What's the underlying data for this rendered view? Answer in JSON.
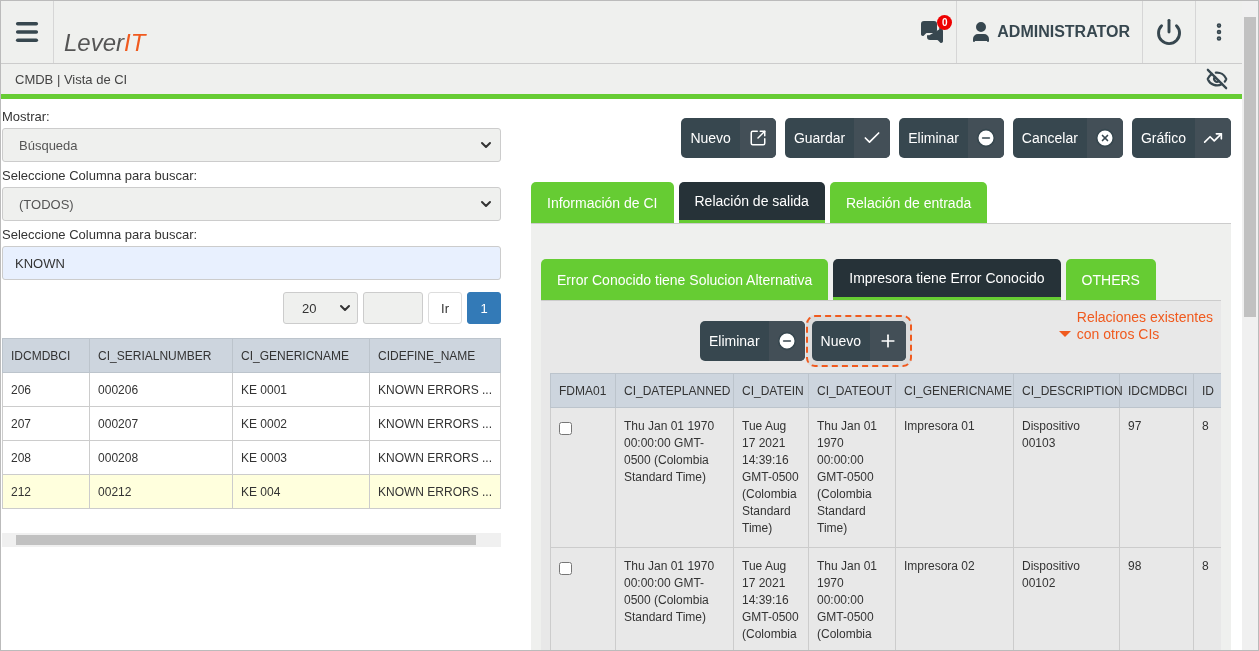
{
  "header": {
    "logo": {
      "text_1": "Lever",
      "text_2": "IT"
    },
    "notifications": {
      "count": "0"
    },
    "user": "ADMINISTRATOR"
  },
  "breadcrumb": "CMDB | Vista de CI",
  "search_panel": {
    "fields": [
      {
        "label": "Mostrar:",
        "kind": "select",
        "value": "Búsqueda"
      },
      {
        "label": "Seleccione Columna para buscar:",
        "kind": "select",
        "value": "(TODOS)"
      },
      {
        "label": "Seleccione Columna para buscar:",
        "kind": "input",
        "value": "KNOWN"
      }
    ],
    "pagination": {
      "page_size": "20",
      "go_button": "Ir",
      "pages": [
        {
          "label": "1",
          "selected": true
        }
      ]
    },
    "table": {
      "columns": [
        "IDCMDBCI",
        "CI_SERIALNUMBER",
        "CI_GENERICNAME",
        "CIDEFINE_NAME"
      ],
      "rows": [
        {
          "selected": false,
          "cells": [
            "206",
            "000206",
            "KE 0001",
            "KNOWN ERRORS ..."
          ]
        },
        {
          "selected": false,
          "cells": [
            "207",
            "000207",
            "KE 0002",
            "KNOWN ERRORS ..."
          ]
        },
        {
          "selected": false,
          "cells": [
            "208",
            "000208",
            "KE 0003",
            "KNOWN ERRORS ..."
          ]
        },
        {
          "selected": true,
          "cells": [
            "212",
            "00212",
            "KE 004",
            "KNOWN ERRORS ..."
          ]
        }
      ]
    }
  },
  "toolbar": [
    {
      "label": "Nuevo",
      "kind": "new"
    },
    {
      "label": "Guardar",
      "kind": "save"
    },
    {
      "label": "Eliminar",
      "kind": "delete"
    },
    {
      "label": "Cancelar",
      "kind": "cancel"
    },
    {
      "label": "Gráfico",
      "kind": "chart"
    }
  ],
  "tabs": [
    {
      "label": "Información de CI",
      "selected": false
    },
    {
      "label": "Relación de salida",
      "selected": true
    },
    {
      "label": "Relación de entrada",
      "selected": false
    }
  ],
  "subtabs": [
    {
      "label": "Error Conocido tiene Solucion Alternativa",
      "selected": false
    },
    {
      "label": "Impresora tiene Error Conocido",
      "selected": true
    },
    {
      "label": "OTHERS",
      "selected": false
    }
  ],
  "relation_toolbar": [
    {
      "label": "Eliminar",
      "kind": "delete",
      "highlighted": false
    },
    {
      "label": "Nuevo",
      "kind": "add",
      "highlighted": true
    }
  ],
  "callout": {
    "line_1": "Relaciones existentes",
    "line_2": "con otros CIs"
  },
  "relations_table": {
    "columns": [
      "FDMA01",
      "CI_DATEPLANNED",
      "CI_DATEIN",
      "CI_DATEOUT",
      "CI_GENERICNAME",
      "CI_DESCRIPTION",
      "IDCMDBCI",
      "ID"
    ],
    "rows": [
      {
        "checked": false,
        "cells": [
          "",
          "Thu Jan 01 1970\n00:00:00 GMT-\n0500 (Colombia\nStandard Time)",
          "Tue Aug\n17 2021\n14:39:16\nGMT-0500\n(Colombia\nStandard\nTime)",
          "Thu Jan 01\n1970\n00:00:00\nGMT-0500\n(Colombia\nStandard\nTime)",
          "Impresora 01",
          "Dispositivo\n00103",
          "97",
          "8"
        ]
      },
      {
        "checked": false,
        "cells": [
          "",
          "Thu Jan 01 1970\n00:00:00 GMT-\n0500 (Colombia\nStandard Time)",
          "Tue Aug\n17 2021\n14:39:16\nGMT-0500\n(Colombia",
          "Thu Jan 01\n1970\n00:00:00\nGMT-0500\n(Colombia",
          "Impresora 02",
          "Dispositivo\n00102",
          "98",
          "8"
        ]
      }
    ]
  }
}
